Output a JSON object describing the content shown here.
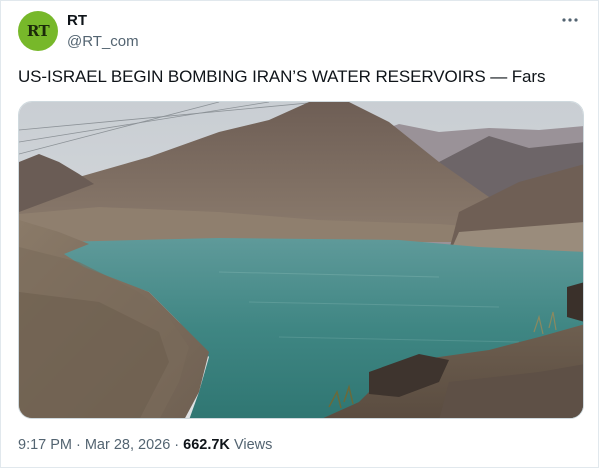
{
  "author": {
    "name": "RT",
    "handle": "@RT_com",
    "avatar_text": "RT",
    "avatar_color": "#77b82a"
  },
  "menu": {
    "icon": "more-horizontal-icon"
  },
  "tweet": {
    "text": "US-ISRAEL BEGIN BOMBING IRAN’S WATER RESERVOIRS — Fars"
  },
  "media": {
    "scene": "mountain-reservoir-photo"
  },
  "meta": {
    "time": "9:17 PM",
    "separator": "·",
    "date": "Mar 28, 2026",
    "views_count": "662.7K",
    "views_label": "Views"
  }
}
